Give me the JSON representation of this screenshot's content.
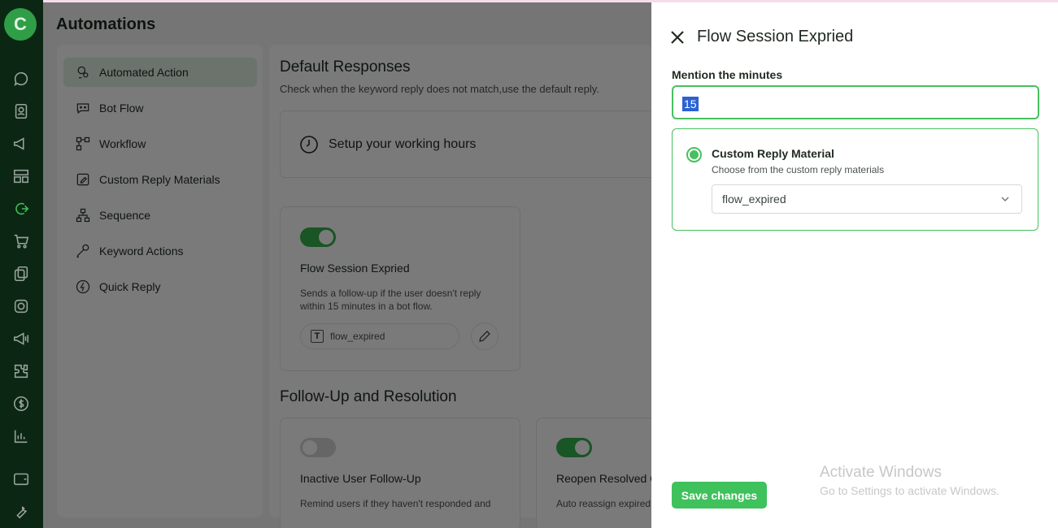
{
  "app": {
    "logo_letter": "C",
    "title": "Automations"
  },
  "nav": {
    "items": [
      {
        "label": "Automated Action",
        "icon": "automation-icon",
        "active": true
      },
      {
        "label": "Bot Flow",
        "icon": "bot-icon",
        "active": false
      },
      {
        "label": "Workflow",
        "icon": "workflow-icon",
        "active": false
      },
      {
        "label": "Custom Reply Materials",
        "icon": "note-edit-icon",
        "active": false
      },
      {
        "label": "Sequence",
        "icon": "sequence-icon",
        "active": false
      },
      {
        "label": "Keyword Actions",
        "icon": "key-icon",
        "active": false
      },
      {
        "label": "Quick Reply",
        "icon": "lightning-icon",
        "active": false
      }
    ]
  },
  "content": {
    "default_responses": {
      "title": "Default Responses",
      "subtitle": "Check when the keyword reply does not match,use the default reply.",
      "working_hours_label": "Setup your working hours"
    },
    "flow_card": {
      "title": "Flow Session Expried",
      "description": "Sends a follow-up if the user doesn't reply within 15 minutes in a bot flow.",
      "material": "flow_expired",
      "toggle_on": true
    },
    "follow_up": {
      "title": "Follow-Up and Resolution",
      "cards": [
        {
          "title": "Inactive User Follow-Up",
          "description": "Remind users if they haven't responded and",
          "toggle_on": false
        },
        {
          "title": "Reopen Resolved C",
          "description": "Auto reassign expired",
          "toggle_on": true
        }
      ]
    }
  },
  "drawer": {
    "title": "Flow Session Expried",
    "minutes_label": "Mention the minutes",
    "minutes_value": "15",
    "option": {
      "title": "Custom Reply Material",
      "subtitle": "Choose from the custom reply materials",
      "selected": "flow_expired"
    },
    "save_label": "Save changes"
  },
  "watermark": {
    "line1": "Activate Windows",
    "line2": "Go to Settings to activate Windows."
  },
  "colors": {
    "accent": "#3fc15c",
    "rail": "#0b2713"
  }
}
